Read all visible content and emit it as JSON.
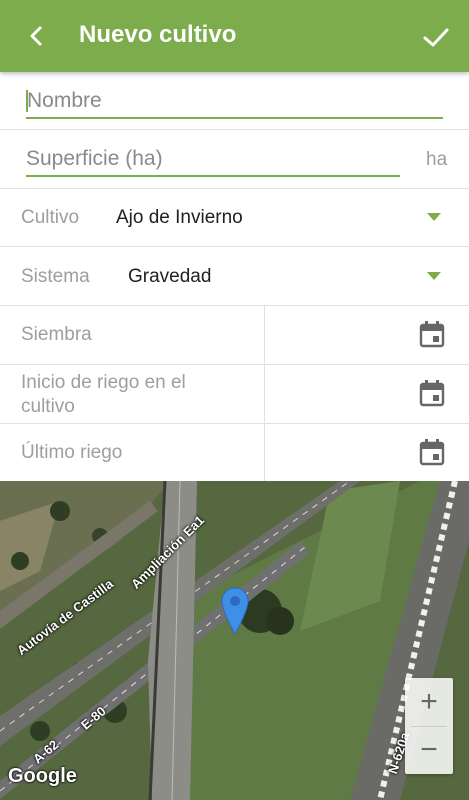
{
  "header": {
    "title": "Nuevo cultivo",
    "back_icon": "chevron-left-icon",
    "confirm_icon": "check-icon"
  },
  "form": {
    "name": {
      "placeholder": "Nombre",
      "value": ""
    },
    "surface": {
      "placeholder": "Superficie (ha)",
      "value": "",
      "unit": "ha"
    },
    "crop": {
      "label": "Cultivo",
      "value": "Ajo de Invierno"
    },
    "system": {
      "label": "Sistema",
      "value": "Gravedad"
    },
    "dates": [
      {
        "label": "Siembra"
      },
      {
        "label": "Inicio de riego en el cultivo"
      },
      {
        "label": "Último riego"
      }
    ]
  },
  "map": {
    "road_labels": [
      "Autovía de Castilla",
      "Ampliación Ea1",
      "E-80",
      "A-62",
      "N-620a"
    ],
    "zoom_in": "+",
    "zoom_out": "−",
    "attribution": "Google",
    "marker_icon": "map-pin-icon"
  },
  "colors": {
    "accent": "#7cac4c",
    "marker": "#3f8ee8"
  }
}
